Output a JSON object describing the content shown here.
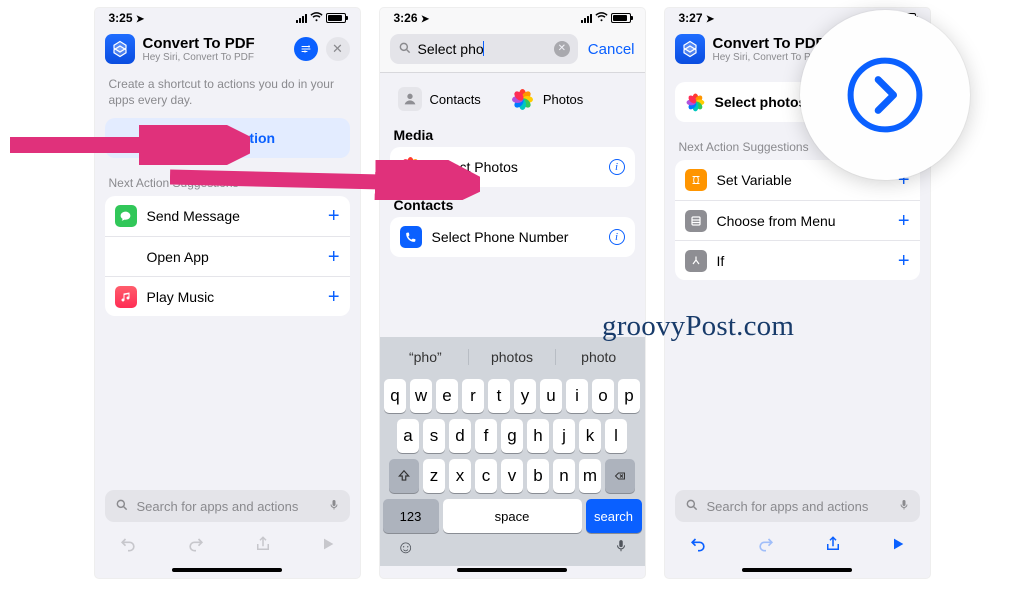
{
  "watermark": "groovyPost.com",
  "screen1": {
    "time": "3:25",
    "title": "Convert To PDF",
    "subtitle": "Hey Siri, Convert To PDF",
    "helper": "Create a shortcut to actions you do in your apps every day.",
    "add_action": "Add Action",
    "suggestions_label": "Next Action Suggestions",
    "rows": [
      {
        "label": "Send Message"
      },
      {
        "label": "Open App"
      },
      {
        "label": "Play Music"
      }
    ],
    "search_placeholder": "Search for apps and actions"
  },
  "screen2": {
    "time": "3:26",
    "query": "Select pho",
    "cancel": "Cancel",
    "cat_contacts": "Contacts",
    "cat_photos": "Photos",
    "group_media": "Media",
    "row_select_photos": "Select Photos",
    "group_contacts": "Contacts",
    "row_select_phone": "Select Phone Number",
    "suggestions": [
      "“pho”",
      "photos",
      "photo"
    ],
    "keys_r1": [
      "q",
      "w",
      "e",
      "r",
      "t",
      "y",
      "u",
      "i",
      "o",
      "p"
    ],
    "keys_r2": [
      "a",
      "s",
      "d",
      "f",
      "g",
      "h",
      "j",
      "k",
      "l"
    ],
    "keys_r3": [
      "z",
      "x",
      "c",
      "v",
      "b",
      "n",
      "m"
    ],
    "k123": "123",
    "space": "space",
    "search": "search"
  },
  "screen3": {
    "time": "3:27",
    "title": "Convert To PDF",
    "subtitle": "Hey Siri, Convert To PDF",
    "pill_label": "Select photos",
    "suggestions_label": "Next Action Suggestions",
    "rows": [
      {
        "label": "Set Variable"
      },
      {
        "label": "Choose from Menu"
      },
      {
        "label": "If"
      }
    ],
    "search_placeholder": "Search for apps and actions"
  }
}
